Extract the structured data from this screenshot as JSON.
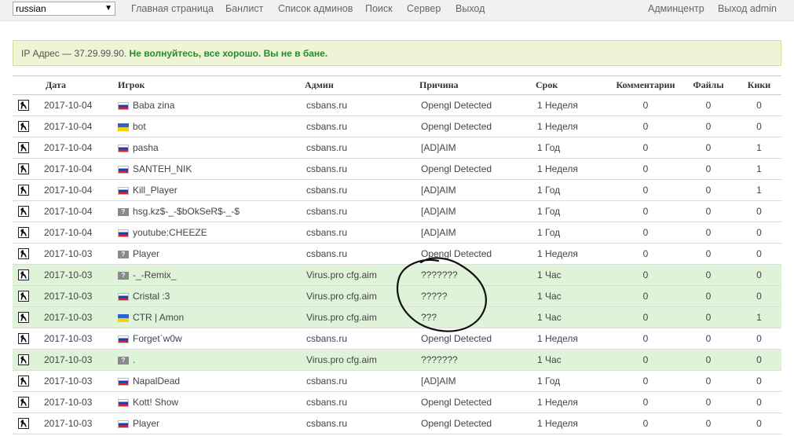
{
  "language": "russian",
  "nav": [
    "Главная страница",
    "Банлист",
    "Список админов",
    "Поиск",
    "Сервер",
    "Выход"
  ],
  "nav_right": [
    "Админцентр",
    "Выход admin"
  ],
  "alert": {
    "prefix": "IP Адрес — 37.29.99.90. ",
    "message": "Не волнуйтесь, все хорошо. Вы не в бане."
  },
  "headers": [
    "Дата",
    "Игрок",
    "Админ",
    "Причина",
    "Срок",
    "Комментарии",
    "Файлы",
    "Кики"
  ],
  "rows": [
    {
      "date": "2017-10-04",
      "flag": "ru",
      "player": "Baba zina",
      "admin": "csbans.ru",
      "reason": "Opengl Detected",
      "term": "1 Неделя",
      "comments": "0",
      "files": "0",
      "kicks": "0",
      "green": false
    },
    {
      "date": "2017-10-04",
      "flag": "ua",
      "player": "bot",
      "admin": "csbans.ru",
      "reason": "Opengl Detected",
      "term": "1 Неделя",
      "comments": "0",
      "files": "0",
      "kicks": "0",
      "green": false
    },
    {
      "date": "2017-10-04",
      "flag": "ru",
      "player": "pasha",
      "admin": "csbans.ru",
      "reason": "[AD]AIM",
      "term": "1 Год",
      "comments": "0",
      "files": "0",
      "kicks": "1",
      "green": false
    },
    {
      "date": "2017-10-04",
      "flag": "ru",
      "player": "SANTEH_NIK",
      "admin": "csbans.ru",
      "reason": "Opengl Detected",
      "term": "1 Неделя",
      "comments": "0",
      "files": "0",
      "kicks": "1",
      "green": false
    },
    {
      "date": "2017-10-04",
      "flag": "ru",
      "player": "Kill_Player",
      "admin": "csbans.ru",
      "reason": "[AD]AIM",
      "term": "1 Год",
      "comments": "0",
      "files": "0",
      "kicks": "1",
      "green": false
    },
    {
      "date": "2017-10-04",
      "flag": "unknown",
      "player": "hsg.kz$-_-$bOkSeR$-_-$",
      "admin": "csbans.ru",
      "reason": "[AD]AIM",
      "term": "1 Год",
      "comments": "0",
      "files": "0",
      "kicks": "0",
      "green": false
    },
    {
      "date": "2017-10-04",
      "flag": "ru",
      "player": "youtube:CHEEZE",
      "admin": "csbans.ru",
      "reason": "[AD]AIM",
      "term": "1 Год",
      "comments": "0",
      "files": "0",
      "kicks": "0",
      "green": false
    },
    {
      "date": "2017-10-03",
      "flag": "unknown",
      "player": "Player",
      "admin": "csbans.ru",
      "reason": "Opengl Detected",
      "term": "1 Неделя",
      "comments": "0",
      "files": "0",
      "kicks": "0",
      "green": false
    },
    {
      "date": "2017-10-03",
      "flag": "unknown",
      "player": "-_-Remix_",
      "admin": "Virus.pro cfg.aim",
      "reason": "???????",
      "term": "1 Час",
      "comments": "0",
      "files": "0",
      "kicks": "0",
      "green": true
    },
    {
      "date": "2017-10-03",
      "flag": "ru",
      "player": "Cristal :3",
      "admin": "Virus.pro cfg.aim",
      "reason": "?????",
      "term": "1 Час",
      "comments": "0",
      "files": "0",
      "kicks": "0",
      "green": true
    },
    {
      "date": "2017-10-03",
      "flag": "ua",
      "player": "CTR | Amon",
      "admin": "Virus.pro cfg.aim",
      "reason": "???",
      "term": "1 Час",
      "comments": "0",
      "files": "0",
      "kicks": "1",
      "green": true
    },
    {
      "date": "2017-10-03",
      "flag": "ru",
      "player": "Forget`w0w",
      "admin": "csbans.ru",
      "reason": "Opengl Detected",
      "term": "1 Неделя",
      "comments": "0",
      "files": "0",
      "kicks": "0",
      "green": false
    },
    {
      "date": "2017-10-03",
      "flag": "unknown",
      "player": ".",
      "admin": "Virus.pro cfg.aim",
      "reason": "???????",
      "term": "1 Час",
      "comments": "0",
      "files": "0",
      "kicks": "0",
      "green": true
    },
    {
      "date": "2017-10-03",
      "flag": "ru",
      "player": "NapalDead",
      "admin": "csbans.ru",
      "reason": "[AD]AIM",
      "term": "1 Год",
      "comments": "0",
      "files": "0",
      "kicks": "0",
      "green": false
    },
    {
      "date": "2017-10-03",
      "flag": "ru",
      "player": "Kott! Show",
      "admin": "csbans.ru",
      "reason": "Opengl Detected",
      "term": "1 Неделя",
      "comments": "0",
      "files": "0",
      "kicks": "0",
      "green": false
    },
    {
      "date": "2017-10-03",
      "flag": "ru",
      "player": "Player",
      "admin": "csbans.ru",
      "reason": "Opengl Detected",
      "term": "1 Неделя",
      "comments": "0",
      "files": "0",
      "kicks": "0",
      "green": false
    }
  ],
  "colors": {
    "green_row": "#def3d8",
    "alert_bg": "#eef4d6",
    "ok_text": "#2a8a2a"
  }
}
